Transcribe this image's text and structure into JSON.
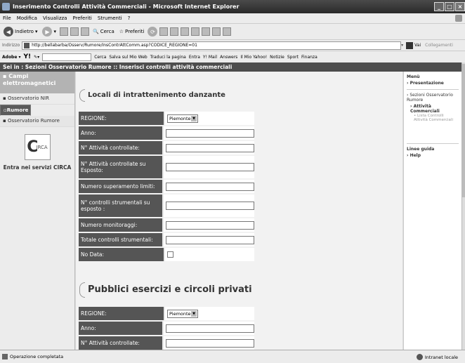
{
  "window": {
    "title": "Inserimento Controlli Attività Commerciali - Microsoft Internet Explorer"
  },
  "menu": [
    "File",
    "Modifica",
    "Visualizza",
    "Preferiti",
    "Strumenti",
    "?"
  ],
  "toolbar": {
    "back": "Indietro",
    "search": "Cerca",
    "favorites": "Preferiti"
  },
  "address": {
    "label": "Indirizzo",
    "url": "http://bellabarba/Osserv/Rumore/InsContrAttComm.asp?CODICE_REGIONE=01",
    "go": "Vai",
    "links": "Collegamenti"
  },
  "yahoobar": {
    "search": "Cerca",
    "items": [
      "Salva sul Mio Web",
      "Traduci la pagina",
      "Entra",
      "Y! Mail",
      "Answers",
      "Il Mio Yahoo!",
      "Notizie",
      "Sport",
      "Finanza"
    ]
  },
  "breadcrumb": "Sei in : Sezioni Osservatorio Rumore :: Inserisci controlli attività commerciali",
  "leftnav": {
    "items": [
      "Campi elettromagnetici",
      "Osservatorio NIR",
      "Rumore",
      "Osservatorio Rumore"
    ],
    "logo_text": "CIRCA",
    "entra": "Entra nei servizi CIRCA"
  },
  "section1": {
    "title": "Locali di intrattenimento danzante",
    "rows": [
      {
        "label": "REGIONE:",
        "type": "select",
        "value": "Piemonte"
      },
      {
        "label": "Anno:",
        "type": "input"
      },
      {
        "label": "N° Attività controllate:",
        "type": "input"
      },
      {
        "label": "N° Attività controllate su Esposto:",
        "type": "input"
      },
      {
        "label": "Numero superamento limiti:",
        "type": "input"
      },
      {
        "label": "N° controlli strumentali su esposto :",
        "type": "input"
      },
      {
        "label": "Numero monitoraggi:",
        "type": "input"
      },
      {
        "label": "Totale controlli strumentali:",
        "type": "input"
      },
      {
        "label": "No Data:",
        "type": "checkbox"
      }
    ]
  },
  "section2": {
    "title": "Pubblici esercizi e circoli privati",
    "rows": [
      {
        "label": "REGIONE:",
        "type": "select",
        "value": "Piemonte"
      },
      {
        "label": "Anno:",
        "type": "input"
      },
      {
        "label": "N° Attività controllate:",
        "type": "input"
      }
    ]
  },
  "right": {
    "menu_header": "Menù",
    "presentazione": "Presentazione",
    "sezioni": "Sezioni Osservatorio Rumore",
    "attivita": "Attività Commerciali",
    "lista": "Lista Controlli Attività Commerciali",
    "linee_header": "Linee guida",
    "help": "Help"
  },
  "status": {
    "left": "Operazione completata",
    "right": "Intranet locale"
  }
}
